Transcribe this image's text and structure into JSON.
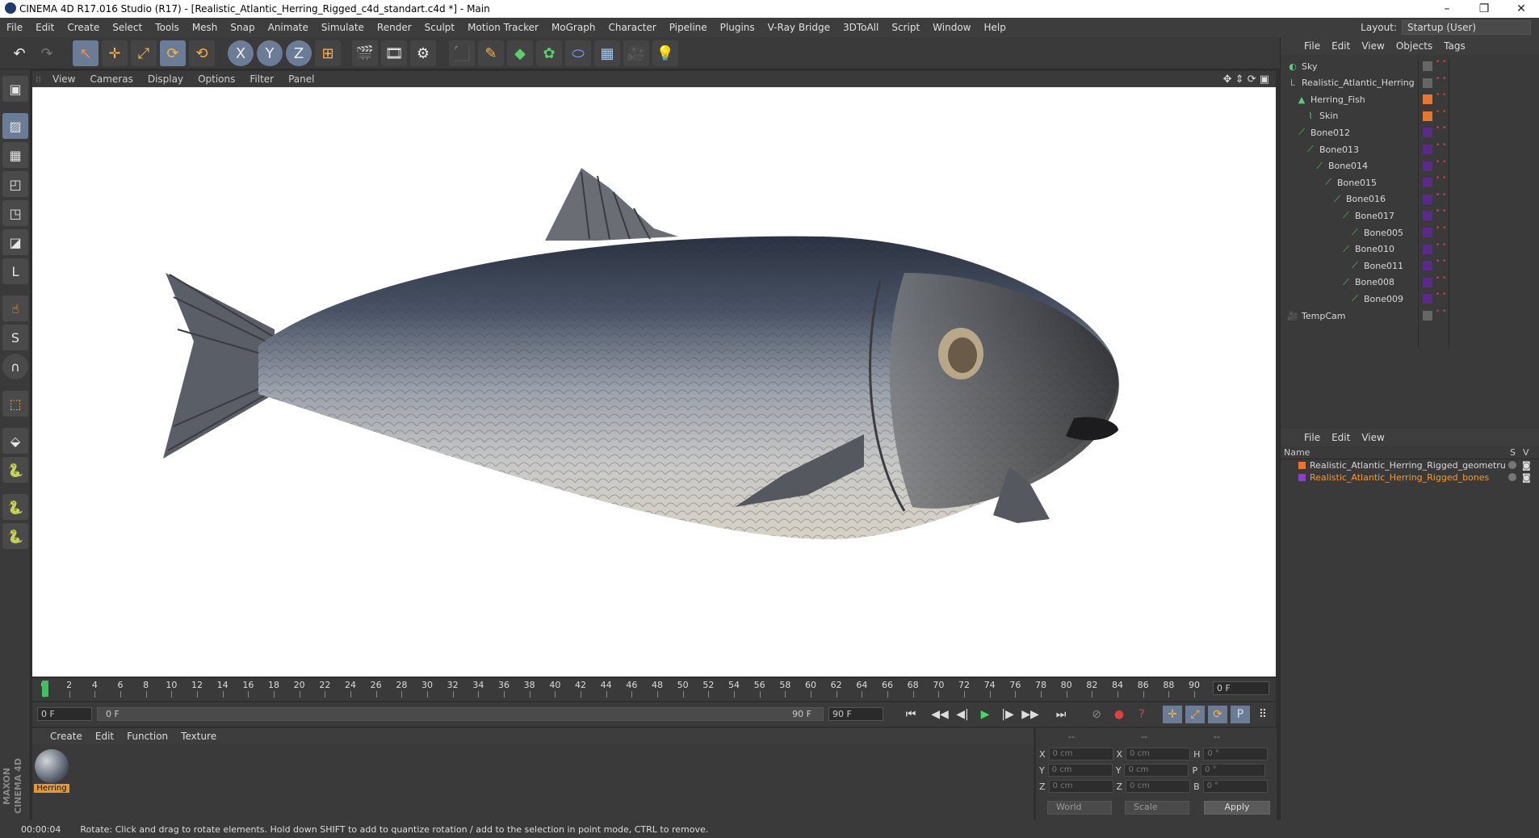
{
  "window": {
    "title": "CINEMA 4D R17.016 Studio (R17) - [Realistic_Atlantic_Herring_Rigged_c4d_standart.c4d *] - Main",
    "minimize": "–",
    "restore": "❐",
    "close": "✕"
  },
  "menu": [
    "File",
    "Edit",
    "Create",
    "Select",
    "Tools",
    "Mesh",
    "Snap",
    "Animate",
    "Simulate",
    "Render",
    "Sculpt",
    "Motion Tracker",
    "MoGraph",
    "Character",
    "Pipeline",
    "Plugins",
    "V-Ray Bridge",
    "3DToAll",
    "Script",
    "Window",
    "Help"
  ],
  "layout": {
    "label": "Layout:",
    "value": "Startup (User)"
  },
  "toolbar": {
    "undo": "↶",
    "redo": "↷",
    "live_select": "↖",
    "move": "✛",
    "scale": "⤢",
    "rotate": "⟳",
    "recent": "⟲",
    "x_axis": "X",
    "y_axis": "Y",
    "z_axis": "Z",
    "coord_system": "⊞",
    "render_view": "🎬",
    "render_picture": "🎞",
    "render_settings": "⚙",
    "cube": "⬛",
    "pen": "✎",
    "subdivision": "◆",
    "cloner": "✿",
    "deformer": "⬭",
    "floor": "▦",
    "camera": "🎥",
    "light": "💡"
  },
  "leftbar": [
    "▣",
    "▨",
    "▦",
    "◰",
    "◳",
    "◪",
    "L",
    "☝",
    "S",
    "∩",
    "⬚",
    "⬙",
    "🐍",
    "🐍"
  ],
  "viewport": {
    "menu": [
      "View",
      "Cameras",
      "Display",
      "Options",
      "Filter",
      "Panel"
    ],
    "nav_icons": "✥ ⇕ ⟳ ▣"
  },
  "timeline": {
    "ticks": [
      "0",
      "2",
      "4",
      "6",
      "8",
      "10",
      "12",
      "14",
      "16",
      "18",
      "20",
      "22",
      "24",
      "26",
      "28",
      "30",
      "32",
      "34",
      "36",
      "38",
      "40",
      "42",
      "44",
      "46",
      "48",
      "50",
      "52",
      "54",
      "56",
      "58",
      "60",
      "62",
      "64",
      "66",
      "68",
      "70",
      "72",
      "74",
      "76",
      "78",
      "80",
      "82",
      "84",
      "86",
      "88",
      "90"
    ],
    "current_frame": "0 F",
    "start": "0 F",
    "range_start": "0 F",
    "range_end": "90 F",
    "end": "90 F"
  },
  "transport": [
    "⏮",
    "◀◀",
    "◀|",
    "▶",
    "|▶",
    "▶▶",
    "⏭"
  ],
  "material_panel": {
    "menu": [
      "Create",
      "Edit",
      "Function",
      "Texture"
    ],
    "material_name": "Herring"
  },
  "coords": {
    "headers": [
      "--",
      "--",
      "--"
    ],
    "rows": [
      {
        "a": "X",
        "av": "0 cm",
        "b": "X",
        "bv": "0 cm",
        "c": "H",
        "cv": "0 °"
      },
      {
        "a": "Y",
        "av": "0 cm",
        "b": "Y",
        "bv": "0 cm",
        "c": "P",
        "cv": "0 °"
      },
      {
        "a": "Z",
        "av": "0 cm",
        "b": "Z",
        "bv": "0 cm",
        "c": "B",
        "cv": "0 °"
      }
    ],
    "space": "World",
    "mode": "Scale",
    "apply": "Apply"
  },
  "object_manager": {
    "menu": [
      "File",
      "Edit",
      "View",
      "Objects",
      "Tags"
    ],
    "objects": [
      {
        "name": "Sky",
        "indent": 0,
        "icon": "◐"
      },
      {
        "name": "Realistic_Atlantic_Herring",
        "indent": 0,
        "icon": "L"
      },
      {
        "name": "Herring_Fish",
        "indent": 1,
        "icon": "▲"
      },
      {
        "name": "Skin",
        "indent": 2,
        "icon": "⌇"
      },
      {
        "name": "Bone012",
        "indent": 1,
        "icon": "⟋"
      },
      {
        "name": "Bone013",
        "indent": 2,
        "icon": "⟋"
      },
      {
        "name": "Bone014",
        "indent": 3,
        "icon": "⟋"
      },
      {
        "name": "Bone015",
        "indent": 4,
        "icon": "⟋"
      },
      {
        "name": "Bone016",
        "indent": 5,
        "icon": "⟋"
      },
      {
        "name": "Bone017",
        "indent": 6,
        "icon": "⟋"
      },
      {
        "name": "Bone005",
        "indent": 7,
        "icon": "⟋"
      },
      {
        "name": "Bone010",
        "indent": 6,
        "icon": "⟋"
      },
      {
        "name": "Bone011",
        "indent": 7,
        "icon": "⟋"
      },
      {
        "name": "Bone008",
        "indent": 6,
        "icon": "⟋"
      },
      {
        "name": "Bone009",
        "indent": 7,
        "icon": "⟋"
      },
      {
        "name": "TempCam",
        "indent": 0,
        "icon": "🎥"
      }
    ]
  },
  "layer_manager": {
    "menu": [
      "File",
      "Edit",
      "View"
    ],
    "col_name": "Name",
    "col_s": "S",
    "col_v": "V",
    "layers": [
      {
        "name": "Realistic_Atlantic_Herring_Rigged_geometru",
        "color": "#e8762c"
      },
      {
        "name": "Realistic_Atlantic_Herring_Rigged_bones",
        "color": "#8a3fd1"
      }
    ]
  },
  "status": {
    "time": "00:00:04",
    "message": "Rotate: Click and drag to rotate elements. Hold down SHIFT to add to quantize rotation / add to the selection in point mode, CTRL to remove."
  },
  "branding": "MAXON CINEMA 4D"
}
